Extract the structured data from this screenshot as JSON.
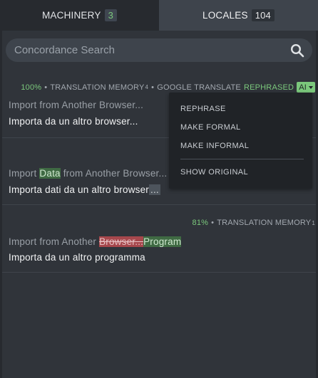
{
  "tabs": [
    {
      "label": "MACHINERY",
      "count": "3"
    },
    {
      "label": "LOCALES",
      "count": "104"
    }
  ],
  "search": {
    "placeholder": "Concordance Search",
    "icon": "search-icon"
  },
  "entries": [
    {
      "quality": "100%",
      "separator": "•",
      "sources": "TRANSLATION MEMORY",
      "sources_count": "4",
      "engine": "GOOGLE TRANSLATE",
      "rephrased": "REPHRASED",
      "ai_label": "AI",
      "original": "Import from Another Browser...",
      "translation": "Importa da un altro browser..."
    },
    {
      "original_before": "Import ",
      "original_inserted": "Data",
      "original_after": " from Another Browser...",
      "translation_text": "Importa dati da un altro browser",
      "translation_trunc": "..."
    },
    {
      "quality": "81%",
      "separator": "•",
      "sources": "TRANSLATION MEMORY",
      "sources_count": "1",
      "original_before": "Import from Another ",
      "original_deleted": "Browser...",
      "original_inserted": "Program",
      "translation": "Importa da un altro programma"
    }
  ],
  "ai_menu": {
    "items": [
      "REPHRASE",
      "MAKE FORMAL",
      "MAKE INFORMAL"
    ],
    "show_original": "SHOW ORIGINAL"
  },
  "colors": {
    "accent_green": "#7bc87c",
    "deletion_red": "#a6474c",
    "background": "#272a2f",
    "panel": "#30343a"
  }
}
